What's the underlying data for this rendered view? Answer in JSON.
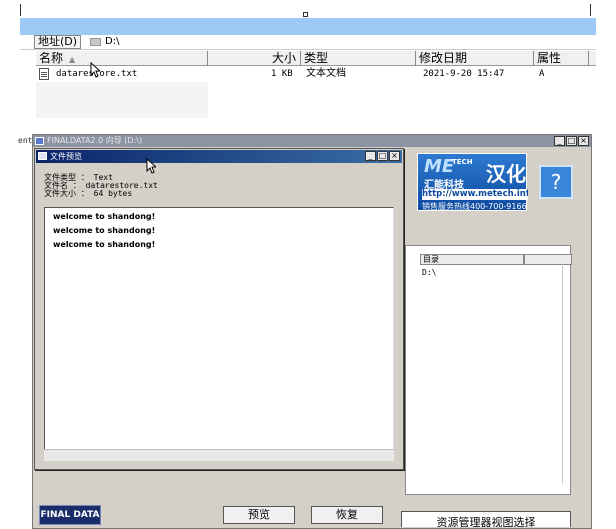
{
  "explorer": {
    "address_label": "地址(D)",
    "address_path": "D:\\",
    "columns": [
      "名称",
      "大小",
      "类型",
      "修改日期",
      "属性"
    ],
    "file": {
      "name": "datarestore.txt",
      "size": "1 KB",
      "type": "文本文档",
      "modified": "2021-9-20 15:47",
      "attributes": "A"
    }
  },
  "bg_window": {
    "title": "FINALDATA2.0 向导 (D:\\)",
    "left_edge_text": "ent",
    "banner": {
      "logo": "ME",
      "logo_sub": "TECH",
      "brand": "汇能科技",
      "hanhua": "汉化",
      "url": "http://www.metech.info",
      "hotline": "销售服务热线400-700-9166"
    },
    "help_label": "?",
    "dir_column": "目录",
    "dir_value": "D:\\",
    "logo_text": "FINAL DATA",
    "preview_button": "预览",
    "restore_button": "恢复",
    "explorer_button": "资源管理器视图选择"
  },
  "dialog": {
    "title": "文件预览",
    "info": {
      "type_line": "文件类型 ： Text",
      "name_line": "文件名 ： datarestore.txt",
      "size_line": "文件大小 ： 64 bytes"
    },
    "lines": [
      "welcome to shandong!",
      "welcome to shandong!",
      "welcome to shandong!"
    ]
  },
  "window_controls": {
    "minimize": "_",
    "maximize": "□",
    "close": "×"
  }
}
